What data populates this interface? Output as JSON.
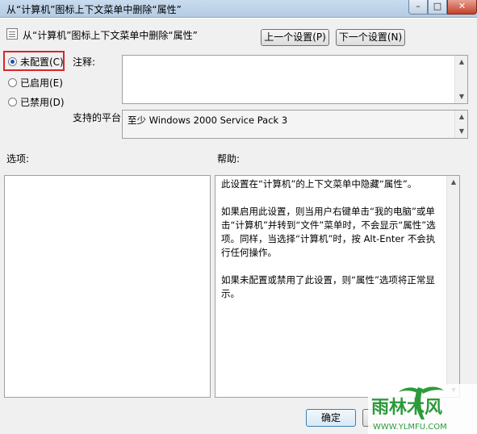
{
  "window": {
    "title": "从“计算机”图标上下文菜单中删除“属性”",
    "controls": {
      "minimize": "–",
      "maximize": "□",
      "close": "✕"
    }
  },
  "header": {
    "policy_name": "从“计算机”图标上下文菜单中删除“属性”",
    "prev_button": "上一个设置(P)",
    "next_button": "下一个设置(N)"
  },
  "state": {
    "options": [
      {
        "label": "未配置(C)",
        "selected": true
      },
      {
        "label": "已启用(E)",
        "selected": false
      },
      {
        "label": "已禁用(D)",
        "selected": false
      }
    ]
  },
  "comment": {
    "label": "注释:",
    "value": ""
  },
  "supported": {
    "label": "支持的平台:",
    "value": "至少 Windows 2000 Service Pack 3"
  },
  "options_panel": {
    "label": "选项:"
  },
  "help_panel": {
    "label": "帮助:",
    "paragraphs": [
      "此设置在“计算机”的上下文菜单中隐藏“属性”。",
      "如果启用此设置，则当用户右键单击“我的电脑”或单击“计算机”并转到“文件”菜单时，不会显示“属性”选项。同样，当选择“计算机”时，按 Alt-Enter 不会执行任何操作。",
      "如果未配置或禁用了此设置，则“属性”选项将正常显示。"
    ]
  },
  "footer": {
    "ok_button": "确定"
  },
  "watermark": {
    "brand": "雨林木风",
    "url": "WWW.YLMFU.COM"
  },
  "colors": {
    "accent": "#1a4fb3",
    "highlight": "#d9252e",
    "watermark_green": "#2c9a3b"
  }
}
